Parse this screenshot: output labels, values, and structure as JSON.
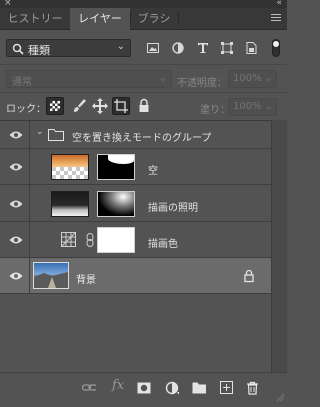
{
  "window": {
    "close_glyph": "×",
    "collapse_glyph": "«"
  },
  "tabs": [
    {
      "label": "ヒストリー",
      "active": false
    },
    {
      "label": "レイヤー",
      "active": true
    },
    {
      "label": "ブラシ",
      "active": false
    }
  ],
  "filter": {
    "kind_label": "種類",
    "icons": [
      "image-filter-icon",
      "adjustment-filter-icon",
      "type-filter-icon",
      "shape-filter-icon",
      "smartobject-filter-icon",
      "filter-toggle-icon"
    ]
  },
  "blend": {
    "mode": "通常",
    "opacity_label": "不透明度：",
    "opacity_value": "100%"
  },
  "lock": {
    "label": "ロック：",
    "fill_label": "塗り：",
    "fill_value": "100%"
  },
  "layers": [
    {
      "name": "空を置き換えモードのグループ",
      "type": "group",
      "expanded": true
    },
    {
      "name": "空",
      "type": "raster-with-mask"
    },
    {
      "name": "描画の照明",
      "type": "raster-with-mask"
    },
    {
      "name": "描画色",
      "type": "adjustment-fill"
    },
    {
      "name": "背景",
      "type": "background",
      "selected": true,
      "locked": true
    }
  ],
  "bottom_icons": [
    "link-icon",
    "fx-icon",
    "add-mask-icon",
    "adjustment-layer-icon",
    "new-group-icon",
    "new-layer-icon",
    "delete-icon"
  ],
  "fx_label": "fx",
  "colors": {
    "panel": "#535353",
    "tabbar": "#383838",
    "selected_row": "#6b6b6b"
  }
}
